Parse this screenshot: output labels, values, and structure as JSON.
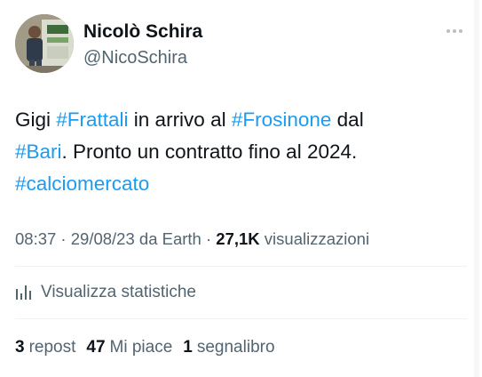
{
  "author": {
    "display_name": "Nicolò Schira",
    "handle": "@NicoSchira"
  },
  "tweet": {
    "parts": [
      {
        "text": "Gigi ",
        "hashtag": false
      },
      {
        "text": "#Frattali",
        "hashtag": true
      },
      {
        "text": " in arrivo al ",
        "hashtag": false
      },
      {
        "text": "#Frosinone",
        "hashtag": true
      },
      {
        "text": " dal ",
        "hashtag": false
      },
      {
        "text": "#Bari",
        "hashtag": true
      },
      {
        "text": ". Pronto un contratto fino al 2024. ",
        "hashtag": false
      },
      {
        "text": "#calciomercato",
        "hashtag": true
      }
    ]
  },
  "meta": {
    "time": "08:37",
    "separator1": " · ",
    "date": "29/08/23",
    "source": " da Earth",
    "separator2": " · ",
    "views_count": "27,1K",
    "views_label": " visualizzazioni"
  },
  "stats": {
    "label": "Visualizza statistiche",
    "icon": "bar-chart-icon"
  },
  "engagement": {
    "reposts_count": "3",
    "reposts_label": "repost",
    "likes_count": "47",
    "likes_label": "Mi piace",
    "bookmarks_count": "1",
    "bookmarks_label": "segnalibro"
  },
  "icons": {
    "more": "more-options-icon",
    "avatar": "avatar"
  },
  "colors": {
    "accent": "#1d9bf0",
    "text": "#0f1419",
    "secondary": "#536471",
    "divider": "#eff3f4"
  }
}
